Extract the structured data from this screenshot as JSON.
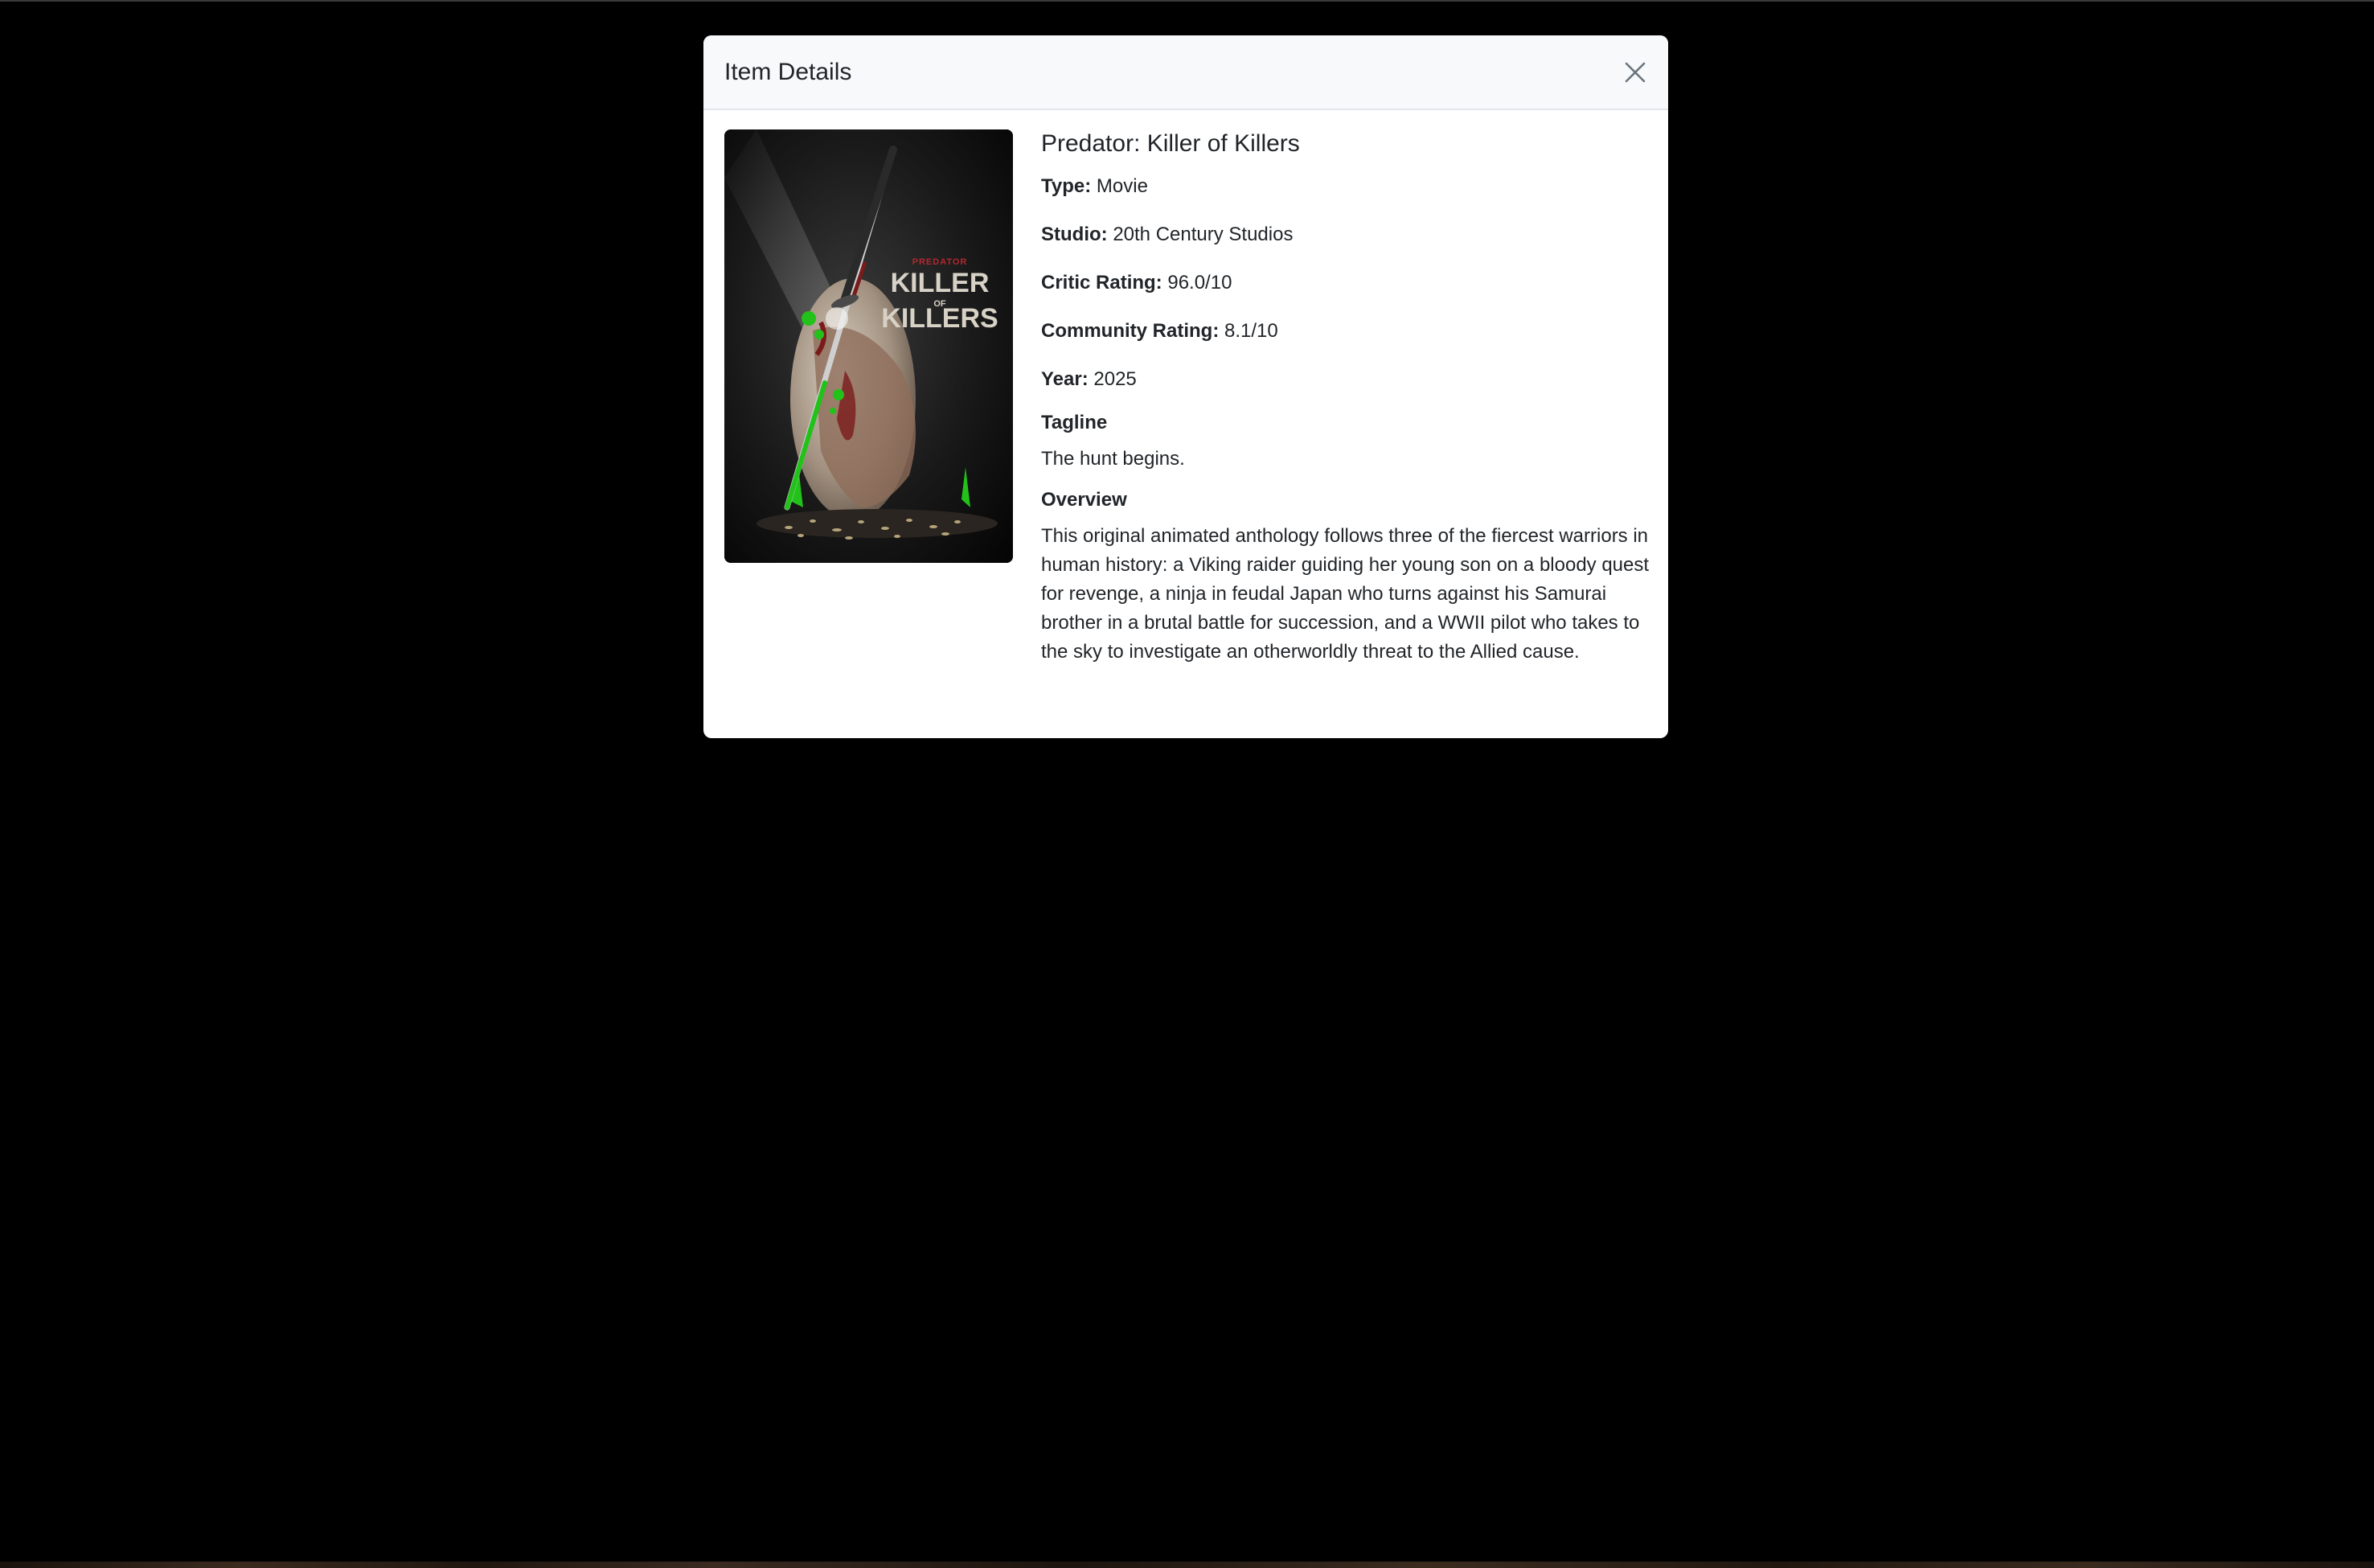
{
  "modal": {
    "title": "Item Details",
    "close_icon": "close-icon"
  },
  "item": {
    "title": "Predator: Killer of Killers",
    "poster_text": {
      "brand": "PREDATOR",
      "line1": "KILLER",
      "line2": "OF",
      "line3": "KILLERS"
    },
    "fields": [
      {
        "label": "Type:",
        "value": "Movie"
      },
      {
        "label": "Studio:",
        "value": "20th Century Studios"
      },
      {
        "label": "Critic Rating:",
        "value": "96.0/10"
      },
      {
        "label": "Community Rating:",
        "value": "8.1/10"
      },
      {
        "label": "Year:",
        "value": "2025"
      }
    ],
    "tagline_heading": "Tagline",
    "tagline": "The hunt begins.",
    "overview_heading": "Overview",
    "overview": "This original animated anthology follows three of the fiercest warriors in human history: a Viking raider guiding her young son on a bloody quest for revenge, a ninja in feudal Japan who turns against his Samurai brother in a brutal battle for succession, and a WWII pilot who takes to the sky to investigate an otherworldly threat to the Allied cause."
  },
  "colors": {
    "backdrop": "#000000",
    "header_bg": "#f8f9fa",
    "text": "#212529",
    "accent_green": "#22c21a",
    "poster_red": "#b3272d"
  }
}
